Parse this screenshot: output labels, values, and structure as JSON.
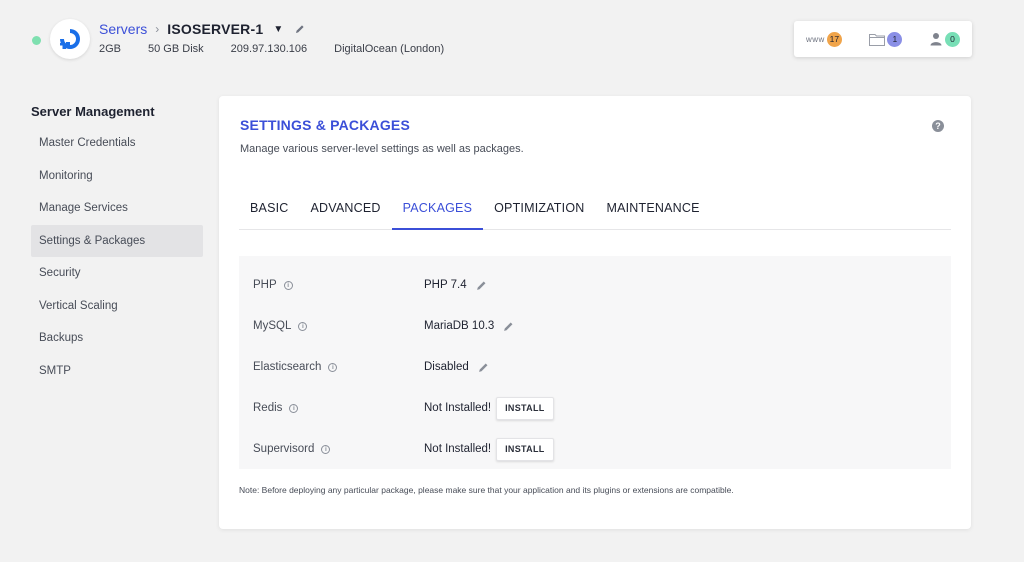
{
  "header": {
    "breadcrumb_root": "Servers",
    "server_name": "ISOSERVER-1",
    "ram": "2GB",
    "disk": "50 GB Disk",
    "ip": "209.97.130.106",
    "provider": "DigitalOcean (London)",
    "status_color": "#7fe0b0"
  },
  "stats": {
    "www_label": "www",
    "apps_count": "17",
    "files_count": "1",
    "users_count": "0"
  },
  "sidebar": {
    "title": "Server Management",
    "items": [
      {
        "label": "Master Credentials",
        "active": false
      },
      {
        "label": "Monitoring",
        "active": false
      },
      {
        "label": "Manage Services",
        "active": false
      },
      {
        "label": "Settings & Packages",
        "active": true
      },
      {
        "label": "Security",
        "active": false
      },
      {
        "label": "Vertical Scaling",
        "active": false
      },
      {
        "label": "Backups",
        "active": false
      },
      {
        "label": "SMTP",
        "active": false
      }
    ]
  },
  "main": {
    "title": "SETTINGS & PACKAGES",
    "subtitle": "Manage various server-level settings as well as packages.",
    "help_icon": "?",
    "tabs": [
      {
        "label": "BASIC",
        "active": false
      },
      {
        "label": "ADVANCED",
        "active": false
      },
      {
        "label": "PACKAGES",
        "active": true
      },
      {
        "label": "OPTIMIZATION",
        "active": false
      },
      {
        "label": "MAINTENANCE",
        "active": false
      }
    ],
    "packages": [
      {
        "name": "PHP",
        "value": "PHP 7.4",
        "action": "edit"
      },
      {
        "name": "MySQL",
        "value": "MariaDB 10.3",
        "action": "edit"
      },
      {
        "name": "Elasticsearch",
        "value": "Disabled",
        "action": "edit"
      },
      {
        "name": "Redis",
        "value": "Not Installed!",
        "action": "install",
        "button_label": "INSTALL"
      },
      {
        "name": "Supervisord",
        "value": "Not Installed!",
        "action": "install",
        "button_label": "INSTALL"
      }
    ],
    "note": "Note: Before deploying any particular package, please make sure that your application and its plugins or extensions are compatible."
  },
  "colors": {
    "accent": "#3b4fd8",
    "badge_orange": "#f0a44a",
    "badge_purple": "#8a8fe6",
    "badge_green": "#78dfb6"
  }
}
